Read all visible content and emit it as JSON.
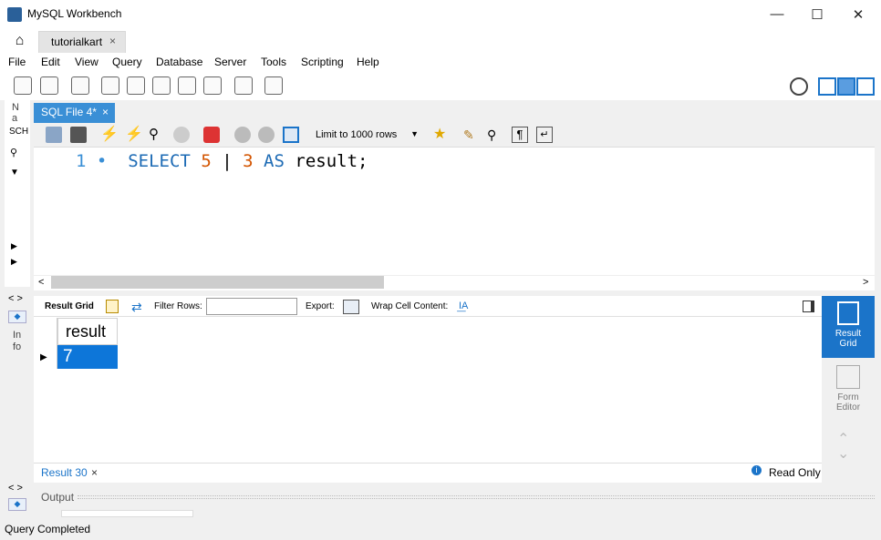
{
  "window": {
    "title": "MySQL Workbench",
    "minimize_glyph": "—",
    "maximize_glyph": "☐",
    "close_glyph": "✕"
  },
  "tabs": {
    "home_icon": "home-icon",
    "connection_tab": "tutorialkart",
    "close_glyph": "×"
  },
  "menu": {
    "items": [
      "File",
      "Edit",
      "View",
      "Query",
      "Database",
      "Server",
      "Tools",
      "Scripting",
      "Help"
    ]
  },
  "sidebar": {
    "nav_label_1": "N",
    "nav_label_2": "a",
    "schemas_label": "SCH",
    "info_label_1": "In",
    "info_label_2": "fo"
  },
  "editor": {
    "tab_label": "SQL File 4*",
    "limit_label": "Limit to 1000 rows",
    "line_number": "1",
    "code": {
      "kw_select": "SELECT",
      "num_a": "5",
      "op": "|",
      "num_b": "3",
      "kw_as": "AS",
      "rest": "result;"
    }
  },
  "results": {
    "grid_label": "Result Grid",
    "filter_label": "Filter Rows:",
    "filter_value": "",
    "export_label": "Export:",
    "wrap_label": "Wrap Cell Content:",
    "column_header": "result",
    "cell_value": "7",
    "result_tab": "Result 30",
    "read_only": "Read Only"
  },
  "right_panel": {
    "result_grid_1": "Result",
    "result_grid_2": "Grid",
    "form_editor_1": "Form",
    "form_editor_2": "Editor"
  },
  "output": {
    "label": "Output"
  },
  "status": {
    "text": "Query Completed"
  },
  "colors": {
    "accent": "#1b74c9",
    "tab_active": "#3a8fd6",
    "keyword": "#1d6bb5",
    "number": "#d35400"
  }
}
